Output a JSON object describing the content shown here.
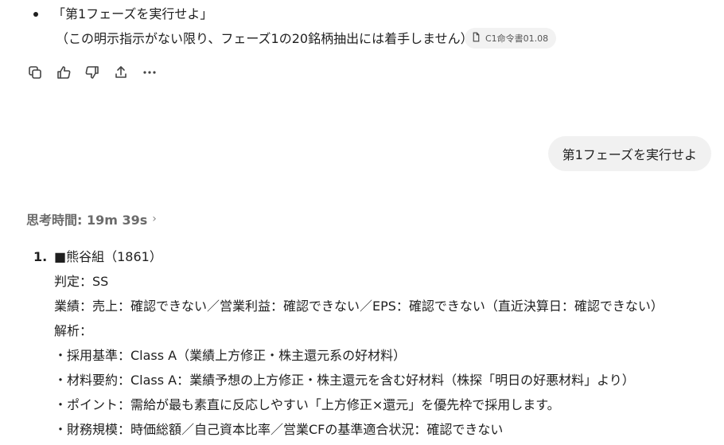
{
  "message": {
    "bullet_text": "「第1フェーズを実行せよ」",
    "sub_text": "（この明示指示がない限り、フェーズ1の20銘柄抽出には着手しません）",
    "citation_label": "C1命令書01.08",
    "citation_icon": "document-icon"
  },
  "actions": {
    "copy_icon": "copy-icon",
    "thumbs_up_icon": "thumbs-up-icon",
    "thumbs_down_icon": "thumbs-down-icon",
    "share_icon": "share-icon",
    "more_icon": "more-icon"
  },
  "user_message": "第1フェーズを実行せよ",
  "thinking": {
    "label": "思考時間: 19m 39s",
    "chevron": "›"
  },
  "answer": {
    "number": "1.",
    "lines": [
      "■熊谷組（1861）",
      "判定：SS",
      "業績：売上：確認できない／営業利益：確認できない／EPS：確認できない（直近決算日：確認できない）",
      "解析：",
      "・採用基準：Class A（業績上方修正・株主還元系の好材料）",
      "・材料要約：Class A：業績予想の上方修正・株主還元を含む好材料（株探「明日の好悪材料」より）",
      "・ポイント：需給が最も素直に反応しやすい「上方修正×還元」を優先枠で採用します。",
      "・財務規模：時価総額／自己資本比率／営業CFの基準適合状況：確認できない"
    ]
  }
}
